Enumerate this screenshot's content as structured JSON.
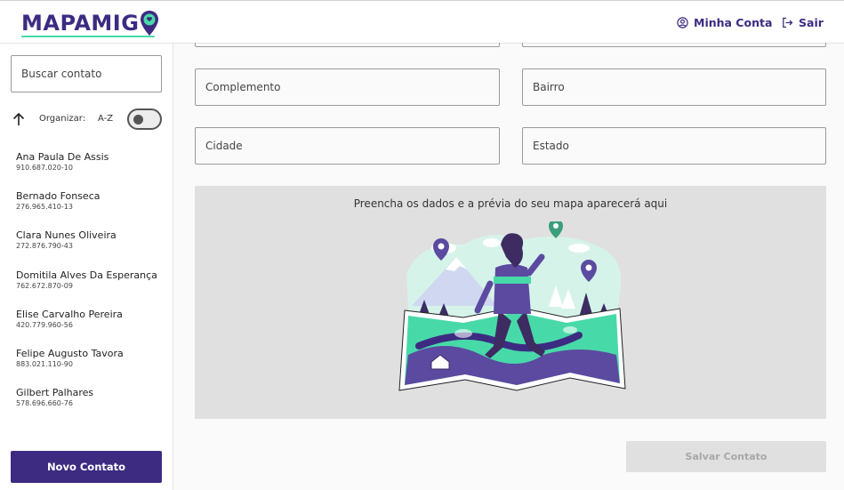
{
  "header": {
    "logo_text": "MAPAMIG",
    "account_label": "Minha Conta",
    "exit_label": "Sair"
  },
  "sidebar": {
    "search_placeholder": "Buscar contato",
    "sort_label": "Organizar:",
    "sort_value": "A-Z",
    "contacts": [
      {
        "name": "Ana Paula De Assis",
        "cpf": "910.687.020-10"
      },
      {
        "name": "Bernado Fonseca",
        "cpf": "276.965.410-13"
      },
      {
        "name": "Clara Nunes Oliveira",
        "cpf": "272.876.790-43"
      },
      {
        "name": "Domitila Alves Da Esperança",
        "cpf": "762.672.870-09"
      },
      {
        "name": "Elise Carvalho Pereira",
        "cpf": "420.779.960-56"
      },
      {
        "name": "Felipe Augusto Tavora",
        "cpf": "883.021.110-90"
      },
      {
        "name": "Gilbert Palhares",
        "cpf": "578.696.660-76"
      }
    ],
    "new_contact_label": "Novo Contato"
  },
  "form": {
    "complemento_placeholder": "Complemento",
    "bairro_placeholder": "Bairro",
    "cidade_placeholder": "Cidade",
    "estado_placeholder": "Estado"
  },
  "map_preview": {
    "caption": "Preencha os dados e a prévia do seu mapa aparecerá aqui"
  },
  "save_label": "Salvar Contato",
  "colors": {
    "brand": "#3d2b82",
    "accent": "#48d9a8",
    "disabled": "#e0e0e0"
  }
}
